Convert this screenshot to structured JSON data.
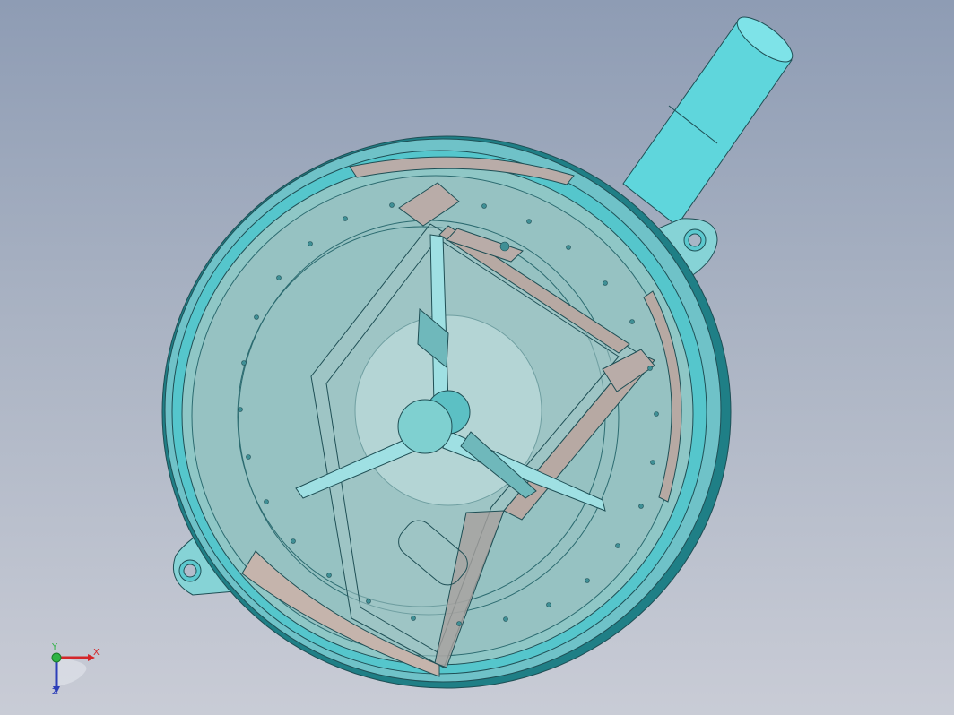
{
  "viewport": {
    "background_top": "#8e9cb4",
    "background_bottom": "#c9ccd6"
  },
  "model": {
    "body_color": "#87c9c8",
    "edge_color": "#1f4f55",
    "shaft_color": "#5fd6dc",
    "brace_color": "#b7a9a3",
    "hub_color": "#7fd0d0"
  },
  "triad": {
    "x_label": "X",
    "y_label": "Y",
    "z_label": "Z",
    "x_color": "#d4262a",
    "y_color": "#2fb344",
    "z_color": "#2d3fb8"
  }
}
